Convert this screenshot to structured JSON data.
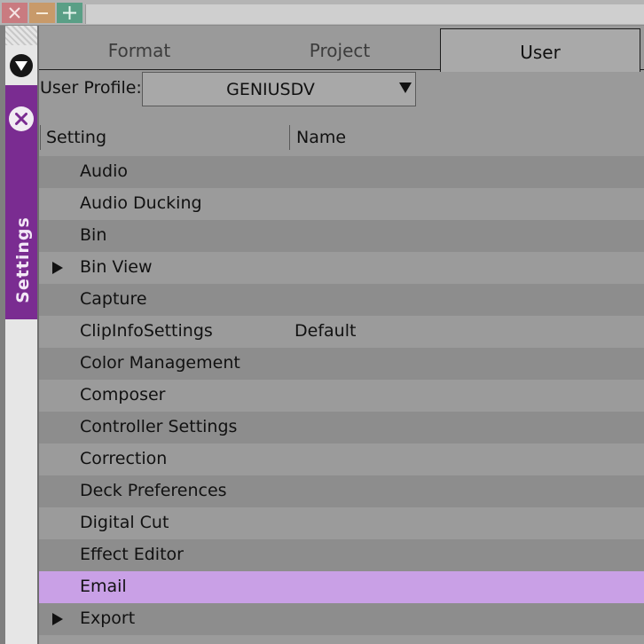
{
  "window_controls": {
    "close_icon": "close-icon",
    "minimize_icon": "minimize-icon",
    "maximize_icon": "plus-icon"
  },
  "side_panel": {
    "menu_icon": "dropdown-circle-icon",
    "tab_label": "Settings",
    "tab_color": "#7a2c91",
    "close_icon": "close-circle-icon"
  },
  "tabs": [
    {
      "label": "Format"
    },
    {
      "label": "Project"
    },
    {
      "label": "User",
      "active": true
    }
  ],
  "profile": {
    "label": "User Profile:",
    "value": "GENIUSDV",
    "dropdown_icon": "triangle-down-icon"
  },
  "table": {
    "columns": [
      "Setting",
      "Name"
    ],
    "rows": [
      {
        "label": "Audio",
        "name": "",
        "expandable": false
      },
      {
        "label": "Audio Ducking",
        "name": "",
        "expandable": false
      },
      {
        "label": "Bin",
        "name": "",
        "expandable": false
      },
      {
        "label": "Bin View",
        "name": "",
        "expandable": true
      },
      {
        "label": "Capture",
        "name": "",
        "expandable": false
      },
      {
        "label": "ClipInfoSettings",
        "name": "Default",
        "expandable": false
      },
      {
        "label": "Color Management",
        "name": "",
        "expandable": false
      },
      {
        "label": "Composer",
        "name": "",
        "expandable": false
      },
      {
        "label": "Controller Settings",
        "name": "",
        "expandable": false
      },
      {
        "label": "Correction",
        "name": "",
        "expandable": false
      },
      {
        "label": "Deck Preferences",
        "name": "",
        "expandable": false
      },
      {
        "label": "Digital Cut",
        "name": "",
        "expandable": false
      },
      {
        "label": "Effect Editor",
        "name": "",
        "expandable": false
      },
      {
        "label": "Email",
        "name": "",
        "expandable": false,
        "selected": true
      },
      {
        "label": "Export",
        "name": "",
        "expandable": true
      },
      {
        "label": "",
        "name": "",
        "expandable": false
      }
    ],
    "selected_color": "#c9a0e6"
  }
}
